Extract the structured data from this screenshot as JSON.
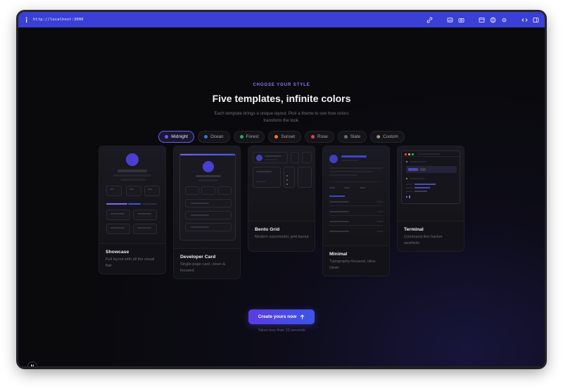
{
  "browser": {
    "url": "http://localhost:3000",
    "accent": "#3a3fd6"
  },
  "hero": {
    "eyebrow": "CHOOSE YOUR STYLE",
    "title": "Five templates, infinite colors",
    "subtitle": "Each template brings a unique layout. Pick a theme to see how colors transform the look."
  },
  "themes": [
    {
      "label": "Midnight",
      "color": "#6b5cf5",
      "active": true
    },
    {
      "label": "Ocean",
      "color": "#2b7de0",
      "active": false
    },
    {
      "label": "Forest",
      "color": "#1fae6a",
      "active": false
    },
    {
      "label": "Sunset",
      "color": "#f07a2a",
      "active": false
    },
    {
      "label": "Rose",
      "color": "#e0405e",
      "active": false
    },
    {
      "label": "Slate",
      "color": "#5d7184",
      "active": false
    },
    {
      "label": "Custom",
      "color": "#c060e0",
      "active": false
    }
  ],
  "templates": [
    {
      "name": "Showcase",
      "description": "Full layout with all the visual flair"
    },
    {
      "name": "Developer Card",
      "description": "Single-page card, clean & focused"
    },
    {
      "name": "Bento Grid",
      "description": "Modern asymmetric grid layout"
    },
    {
      "name": "Minimal",
      "description": "Typography-focused, ultra-clean"
    },
    {
      "name": "Terminal",
      "description": "Command-line hacker aesthetic"
    }
  ],
  "cta": {
    "label": "Create yours now",
    "note": "Takes less than 10 seconds"
  },
  "badge": {
    "letter": "N"
  }
}
